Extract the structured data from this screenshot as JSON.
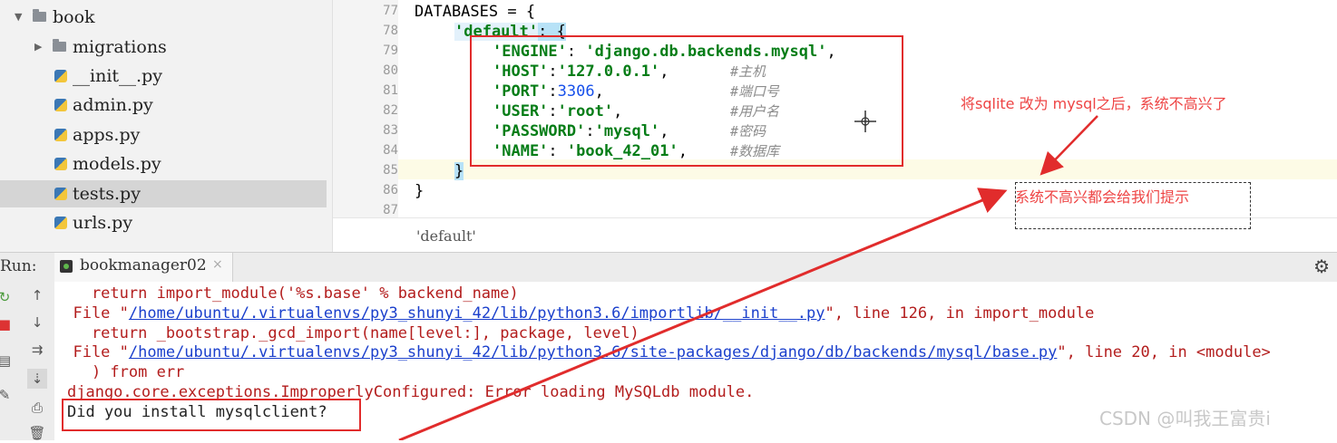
{
  "sidebar": {
    "items": [
      {
        "label": "book",
        "type": "folder",
        "expanded": true
      },
      {
        "label": "migrations",
        "type": "folder",
        "expanded": false
      },
      {
        "label": "__init__.py",
        "type": "python-file"
      },
      {
        "label": "admin.py",
        "type": "python-file"
      },
      {
        "label": "apps.py",
        "type": "python-file"
      },
      {
        "label": "models.py",
        "type": "python-file"
      },
      {
        "label": "tests.py",
        "type": "python-file",
        "selected": true
      },
      {
        "label": "urls.py",
        "type": "python-file"
      }
    ]
  },
  "editor": {
    "line_numbers": [
      "77",
      "78",
      "79",
      "80",
      "81",
      "82",
      "83",
      "84",
      "85",
      "86",
      "87"
    ],
    "lines": {
      "l77": "DATABASES = {",
      "l78_key": "'default'",
      "l78_rest": ": {",
      "l79_key": "'ENGINE'",
      "l79_sep": ": ",
      "l79_val": "'django.db.backends.mysql'",
      "l79_end": ",",
      "l80_key": "'HOST'",
      "l80_sep": ":",
      "l80_val": "'127.0.0.1'",
      "l80_end": ",",
      "l80_cmt": "#主机",
      "l81_key": "'PORT'",
      "l81_sep": ":",
      "l81_val": "3306",
      "l81_end": ",",
      "l81_cmt": "#端口号",
      "l82_key": "'USER'",
      "l82_sep": ":",
      "l82_val": "'root'",
      "l82_end": ",",
      "l82_cmt": "#用户名",
      "l83_key": "'PASSWORD'",
      "l83_sep": ":",
      "l83_val": "'mysql'",
      "l83_end": ",",
      "l83_cmt": "#密码",
      "l84_key": "'NAME'",
      "l84_sep": ": ",
      "l84_val": "'book_42_01'",
      "l84_end": ",",
      "l84_cmt": "#数据库",
      "l85": "}",
      "l86": "}"
    },
    "breadcrumb": "'default'"
  },
  "annotations": {
    "note1": "将sqlite 改为 mysql之后，系统不高兴了",
    "note2": "系统不高兴都会给我们提示"
  },
  "run_panel": {
    "label": "Run:",
    "tab_label": "bookmanager02",
    "tab_close": "×",
    "console_lines": {
      "c1": "    return import_module('%s.base' % backend_name)",
      "c2_pre": "  File \"",
      "c2_link": "/home/ubuntu/.virtualenvs/py3_shunyi_42/lib/python3.6/importlib/__init__.py",
      "c2_post": "\", line 126, in import_module",
      "c3": "    return _bootstrap._gcd_import(name[level:], package, level)",
      "c4_pre": "  File \"",
      "c4_link": "/home/ubuntu/.virtualenvs/py3_shunyi_42/lib/python3.6/site-packages/django/db/backends/mysql/base.py",
      "c4_post": "\", line 20, in <module>",
      "c5": "    ) from err",
      "c6": "django.core.exceptions.ImproperlyConfigured: Error loading MySQLdb module.",
      "c7": "Did you install mysqlclient?"
    }
  },
  "watermark": "CSDN @叫我王富贵i",
  "colors": {
    "annotation_red": "#e12c2c",
    "console_error": "#b31d1d",
    "link_blue": "#1a3fcc",
    "string_green": "#067d17"
  }
}
